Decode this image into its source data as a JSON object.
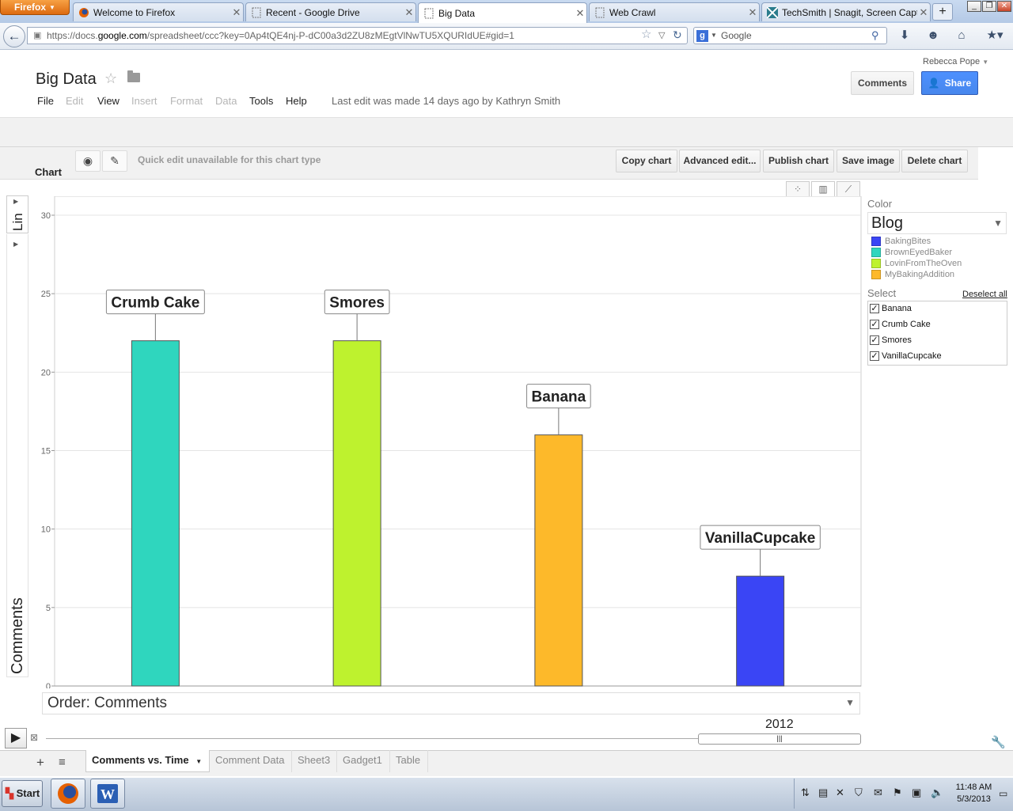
{
  "browser": {
    "app_button": "Firefox",
    "tabs": [
      {
        "label": "Welcome to Firefox",
        "active": false
      },
      {
        "label": "Recent - Google Drive",
        "active": false
      },
      {
        "label": "Big Data",
        "active": true
      },
      {
        "label": "Web Crawl",
        "active": false
      },
      {
        "label": "TechSmith | Snagit, Screen Captur...",
        "active": false
      }
    ],
    "url_prefix": "https://docs.",
    "url_domain": "google.com",
    "url_rest": "/spreadsheet/ccc?key=0Ap4tQE4nj-P-dC00a3d2ZU8zMEgtVlNwTU5XQURIdUE#gid=1",
    "search_engine": "Google"
  },
  "doc": {
    "user": "Rebecca Pope",
    "title": "Big Data",
    "menus": [
      {
        "label": "File",
        "enabled": true
      },
      {
        "label": "Edit",
        "enabled": false
      },
      {
        "label": "View",
        "enabled": true
      },
      {
        "label": "Insert",
        "enabled": false
      },
      {
        "label": "Format",
        "enabled": false
      },
      {
        "label": "Data",
        "enabled": false
      },
      {
        "label": "Tools",
        "enabled": true
      },
      {
        "label": "Help",
        "enabled": true
      }
    ],
    "last_edit": "Last edit was made 14 days ago by Kathryn Smith",
    "comments_button": "Comments",
    "share_button": "Share"
  },
  "chart_toolbar": {
    "label": "Chart",
    "quick_edit_note": "Quick edit unavailable for this chart type",
    "buttons": [
      "Copy chart",
      "Advanced edit...",
      "Publish chart",
      "Save image",
      "Delete chart"
    ]
  },
  "chart_data": {
    "type": "bar",
    "categories": [
      "Crumb Cake",
      "Smores",
      "Banana",
      "VanillaCupcake"
    ],
    "values": [
      22,
      22,
      16,
      7
    ],
    "colors": [
      "#2fd6be",
      "#bef22e",
      "#fdb92a",
      "#3a45f5"
    ],
    "ylabel": "Comments",
    "yticks": [
      0,
      5,
      10,
      15,
      20,
      25,
      30
    ],
    "ylim": [
      0,
      30
    ],
    "grid": true,
    "scale_tab": "Lin"
  },
  "order": {
    "label": "Order: Comments"
  },
  "timeline": {
    "year": "2012"
  },
  "color_panel": {
    "label": "Color",
    "selected": "Blog",
    "legend": [
      {
        "name": "BakingBites",
        "color": "#3a45f5"
      },
      {
        "name": "BrownEyedBaker",
        "color": "#2fd6be"
      },
      {
        "name": "LovinFromTheOven",
        "color": "#bef22e"
      },
      {
        "name": "MyBakingAddition",
        "color": "#fdb92a"
      }
    ]
  },
  "select_panel": {
    "label": "Select",
    "deselect_all": "Deselect all",
    "items": [
      "Banana",
      "Crumb Cake",
      "Smores",
      "VanillaCupcake"
    ]
  },
  "sheets": {
    "tabs": [
      "Comments vs. Time",
      "Comment Data",
      "Sheet3",
      "Gadget1",
      "Table"
    ],
    "active_index": 0
  },
  "taskbar": {
    "start": "Start",
    "time": "11:48 AM",
    "date": "5/3/2013"
  }
}
